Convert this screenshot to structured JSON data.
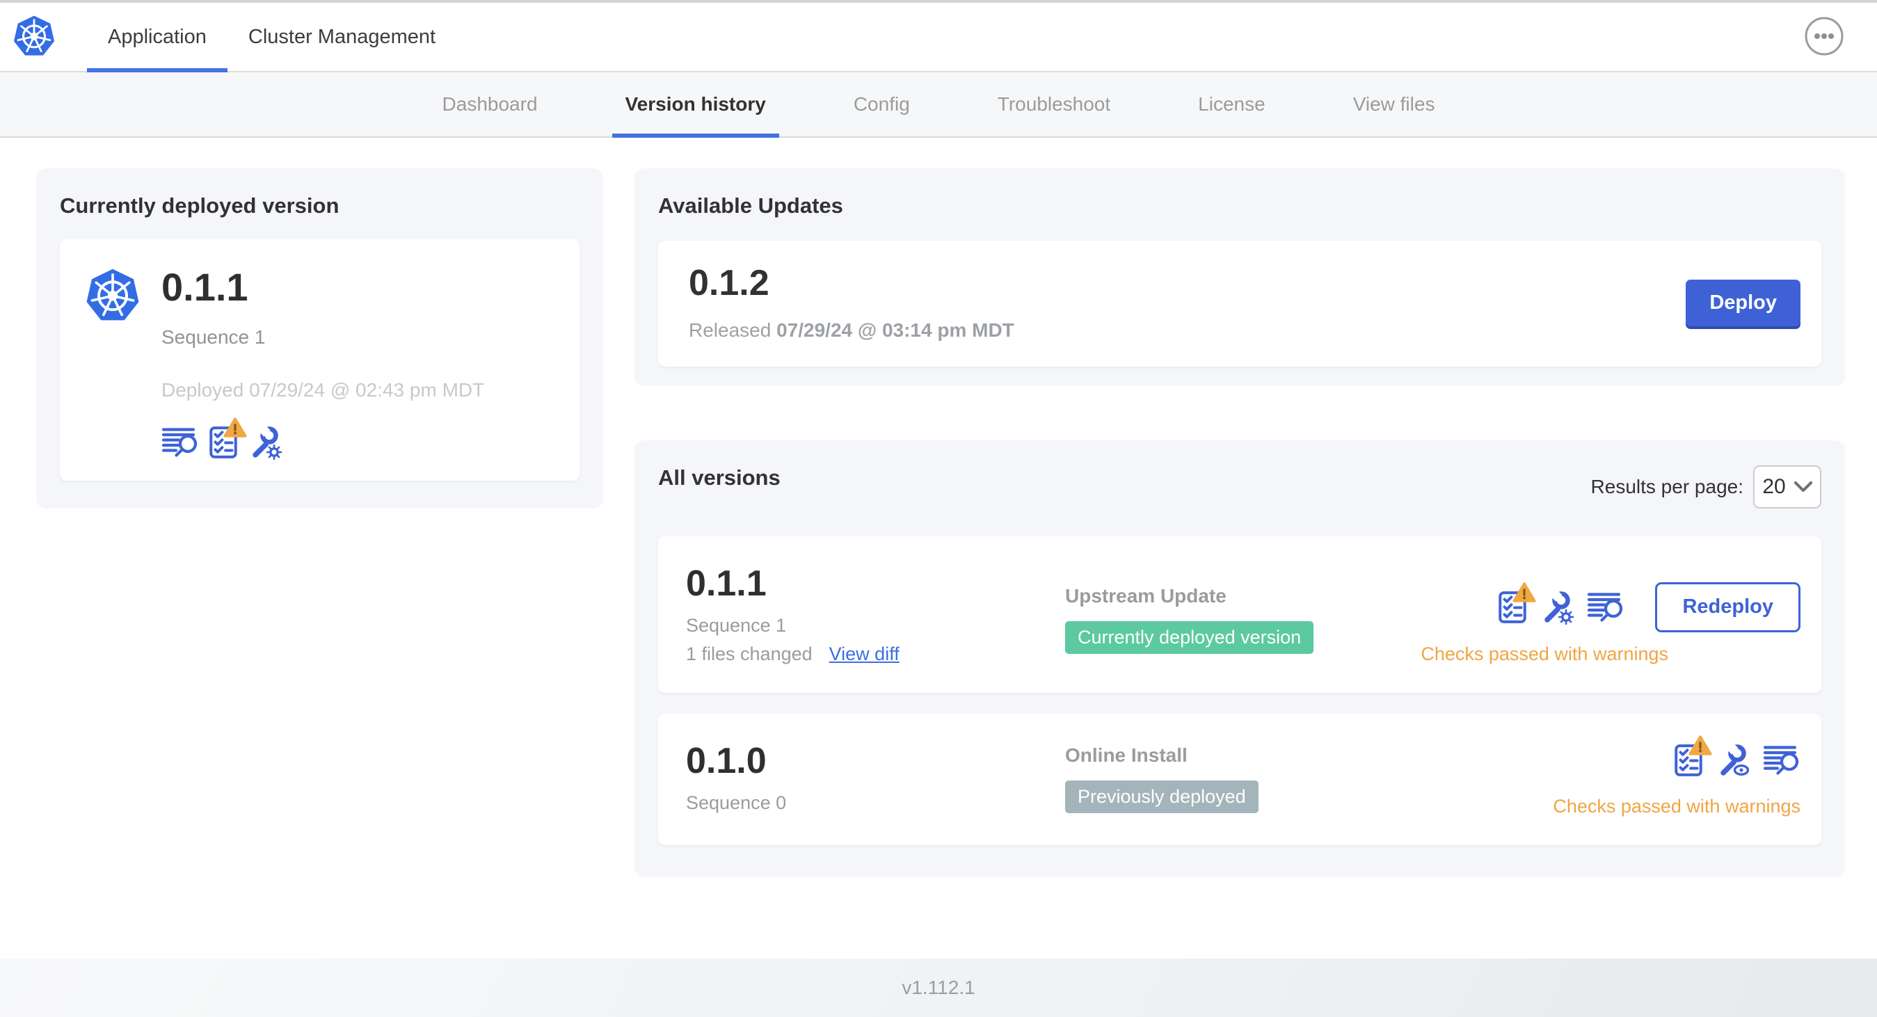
{
  "header": {
    "tabs": [
      {
        "label": "Application",
        "active": true
      },
      {
        "label": "Cluster Management",
        "active": false
      }
    ]
  },
  "subnav": {
    "tabs": [
      {
        "label": "Dashboard",
        "active": false
      },
      {
        "label": "Version history",
        "active": true
      },
      {
        "label": "Config",
        "active": false
      },
      {
        "label": "Troubleshoot",
        "active": false
      },
      {
        "label": "License",
        "active": false
      },
      {
        "label": "View files",
        "active": false
      }
    ]
  },
  "deployed_card": {
    "title": "Currently deployed version",
    "version": "0.1.1",
    "sequence": "Sequence 1",
    "deployed_at": "Deployed 07/29/24 @ 02:43 pm MDT"
  },
  "available_updates": {
    "title": "Available Updates",
    "version": "0.1.2",
    "released_label": "Released",
    "released_at": "07/29/24 @ 03:14 pm MDT",
    "deploy_label": "Deploy"
  },
  "all_versions": {
    "title": "All versions",
    "results_per_page_label": "Results per page:",
    "results_per_page_value": "20",
    "rows": [
      {
        "version": "0.1.1",
        "sequence": "Sequence 1",
        "files_changed": "1 files changed",
        "view_diff_label": "View diff",
        "source": "Upstream Update",
        "badge_label": "Currently deployed version",
        "status": "Checks passed with warnings",
        "action_label": "Redeploy"
      },
      {
        "version": "0.1.0",
        "sequence": "Sequence 0",
        "source": "Online Install",
        "badge_label": "Previously deployed",
        "status": "Checks passed with warnings"
      }
    ]
  },
  "footer": {
    "app_version": "v1.112.1"
  },
  "icons": {
    "app_logo": "kubernetes-logo",
    "more": "ellipsis-icon",
    "diff": "diff-lines-magnifier-icon",
    "preflight": "checklist-warning-icon",
    "edit_config": "wrench-gear-icon",
    "view_config": "wrench-eye-icon",
    "select_chevron": "chevron-down-icon"
  },
  "colors": {
    "accent_blue": "#3e62d6",
    "link_blue": "#3b6fe2",
    "underline_blue": "#4472e2",
    "kubernetes_blue": "#326de6",
    "warning_amber": "#f0a543",
    "badge_green": "#5cc9a1",
    "badge_gray": "#a3b5ba"
  }
}
